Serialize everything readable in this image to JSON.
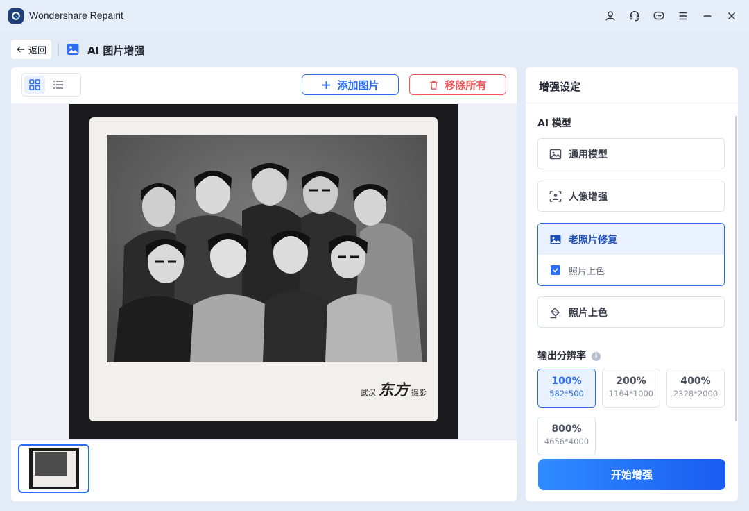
{
  "app": {
    "title": "Wondershare Repairit"
  },
  "header": {
    "back_label": "返回",
    "page_title": "AI 图片增强"
  },
  "toolbar": {
    "add_label": "添加图片",
    "remove_label": "移除所有"
  },
  "photo": {
    "stamp_city": "武汉",
    "stamp_name": "东方",
    "stamp_suffix": "摄影"
  },
  "settings": {
    "title": "增强设定",
    "model_section": "AI 模型",
    "models": [
      {
        "label": "通用模型",
        "icon": "image-icon"
      },
      {
        "label": "人像增强",
        "icon": "portrait-icon"
      },
      {
        "label": "老照片修复",
        "icon": "photo-restore-icon",
        "selected": true,
        "option": "照片上色",
        "option_checked": true
      },
      {
        "label": "照片上色",
        "icon": "paint-bucket-icon"
      }
    ],
    "resolution_section": "输出分辨率",
    "resolutions": [
      {
        "pct": "100%",
        "dim": "582*500",
        "selected": true
      },
      {
        "pct": "200%",
        "dim": "1164*1000"
      },
      {
        "pct": "400%",
        "dim": "2328*2000"
      },
      {
        "pct": "800%",
        "dim": "4656*4000"
      }
    ],
    "start_label": "开始增强"
  },
  "colors": {
    "accent": "#2a6df4",
    "danger": "#f0555a",
    "background": "#e3ebf7"
  }
}
